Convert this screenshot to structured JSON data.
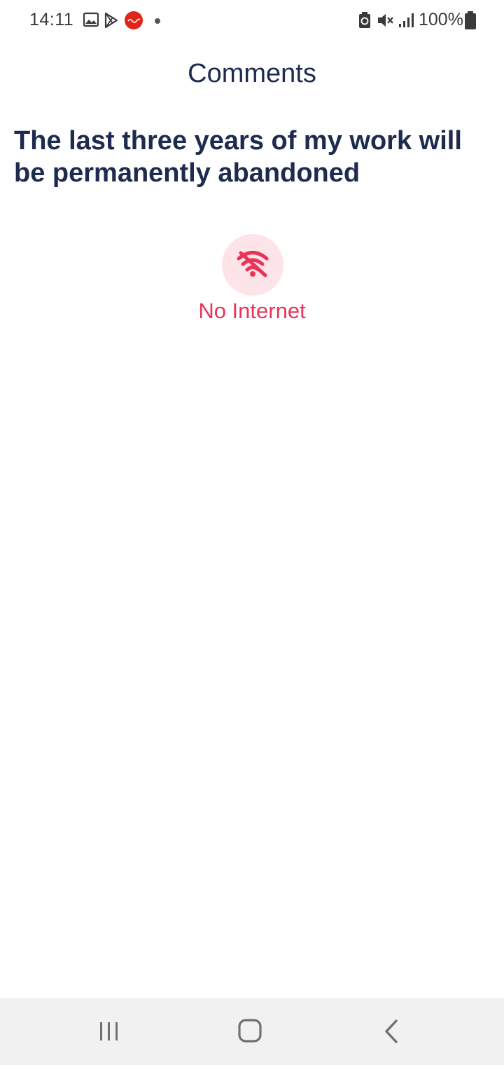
{
  "status_bar": {
    "time": "14:11",
    "battery": "100%",
    "icons": [
      "gallery-icon",
      "play-store-icon",
      "app-notification-icon",
      "more-dot-icon",
      "battery-saver-icon",
      "mute-icon",
      "signal-icon",
      "battery-icon"
    ]
  },
  "header": {
    "title": "Comments"
  },
  "post": {
    "title": "The last three years of my work will be permanently abandoned"
  },
  "offline": {
    "icon": "wifi-off-icon",
    "message": "No Internet",
    "accent_color": "#e8345a",
    "bg_color": "#fde4e8"
  },
  "nav_bar": {
    "buttons": [
      "recent-apps-icon",
      "home-icon",
      "back-icon"
    ]
  }
}
